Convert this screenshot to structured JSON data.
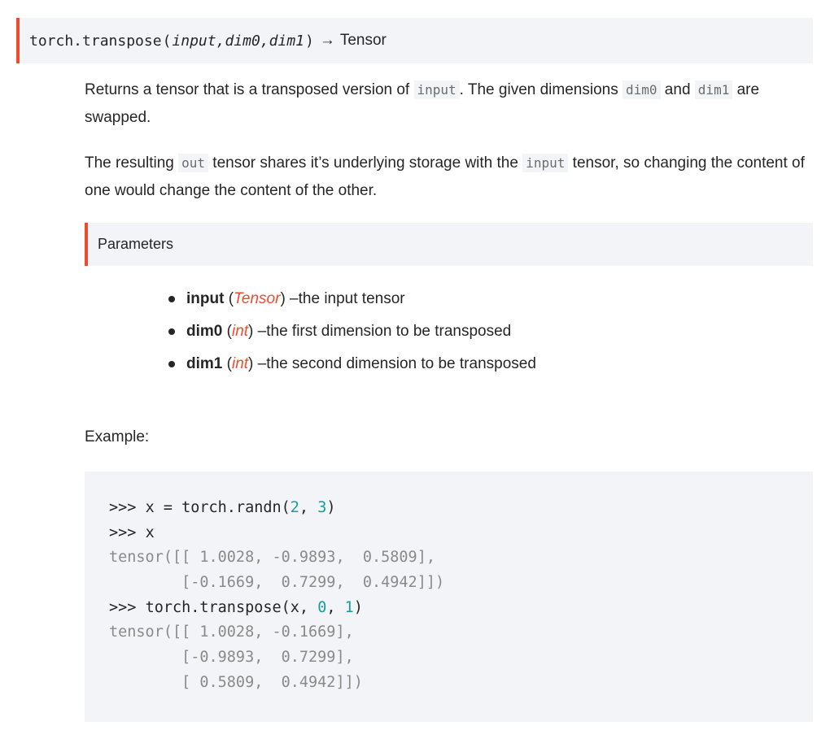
{
  "signature": {
    "function": "torch.transpose",
    "open_paren": "(",
    "args": [
      "input",
      "dim0",
      "dim1"
    ],
    "close_paren": ")",
    "arrow": "→",
    "return_type": "Tensor"
  },
  "description": {
    "p1_a": "Returns a tensor that is a transposed version of ",
    "p1_code1": "input",
    "p1_b": ". The given dimensions ",
    "p1_code2": "dim0",
    "p1_c": " and ",
    "p1_code3": "dim1",
    "p1_d": " are swapped.",
    "p2_a": "The resulting ",
    "p2_code1": "out",
    "p2_b": " tensor shares it’s underlying storage with the ",
    "p2_code2": "input",
    "p2_c": " tensor, so changing the content of one would change the content of the other."
  },
  "parameters": {
    "heading": "Parameters",
    "items": [
      {
        "name": "input",
        "type": "Tensor",
        "desc": "the input tensor"
      },
      {
        "name": "dim0",
        "type": "int",
        "desc": "the first dimension to be transposed"
      },
      {
        "name": "dim1",
        "type": "int",
        "desc": "the second dimension to be transposed"
      }
    ]
  },
  "example": {
    "label": "Example:",
    "lines": [
      {
        "kind": "in",
        "prompt": ">>> ",
        "text": "x = torch.randn(",
        "n1": "2",
        "sep": ", ",
        "n2": "3",
        "end": ")"
      },
      {
        "kind": "in",
        "prompt": ">>> ",
        "text": "x"
      },
      {
        "kind": "out",
        "text": "tensor([[ 1.0028, -0.9893,  0.5809],"
      },
      {
        "kind": "out",
        "text": "        [-0.1669,  0.7299,  0.4942]])"
      },
      {
        "kind": "in",
        "prompt": ">>> ",
        "text": "torch.transpose(x, ",
        "n1": "0",
        "sep": ", ",
        "n2": "1",
        "end": ")"
      },
      {
        "kind": "out",
        "text": "tensor([[ 1.0028, -0.1669],"
      },
      {
        "kind": "out",
        "text": "        [-0.9893,  0.7299],"
      },
      {
        "kind": "out",
        "text": "        [ 0.5809,  0.4942]])"
      }
    ]
  }
}
